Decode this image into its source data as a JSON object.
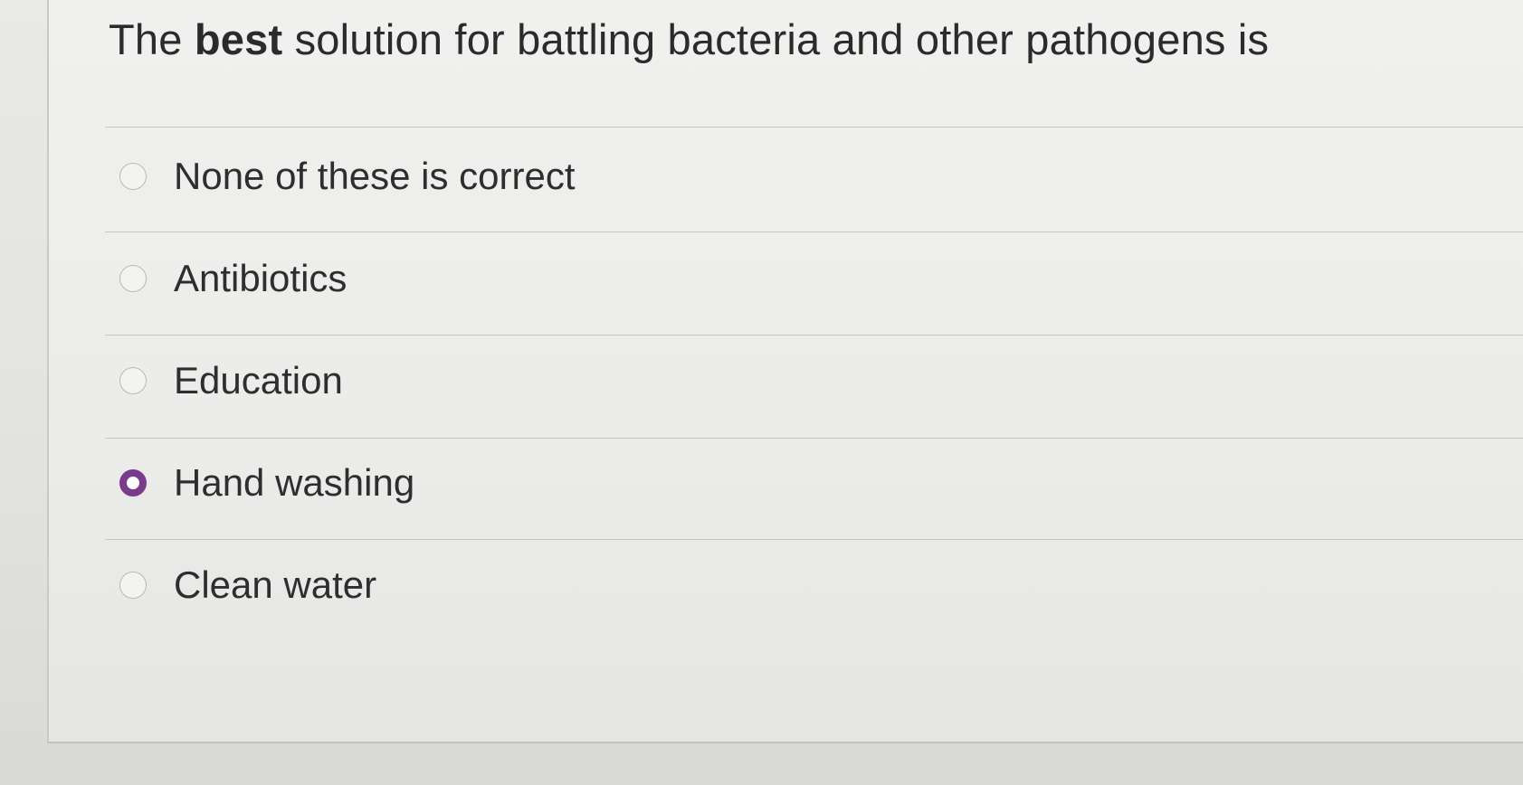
{
  "question": {
    "prefix": "The",
    "emphasis": "best",
    "suffix": "solution for battling bacteria and other pathogens is"
  },
  "options": [
    {
      "label": "None of these is correct",
      "selected": false
    },
    {
      "label": "Antibiotics",
      "selected": false
    },
    {
      "label": "Education",
      "selected": false
    },
    {
      "label": "Hand washing",
      "selected": true
    },
    {
      "label": "Clean water",
      "selected": false
    }
  ],
  "colors": {
    "selected_radio": "#7a3b8a",
    "text": "#2e2e2e"
  }
}
